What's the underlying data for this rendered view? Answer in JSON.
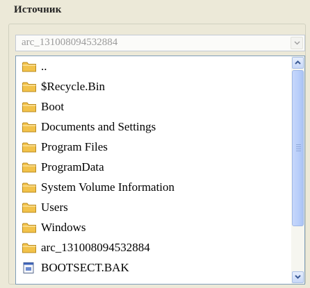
{
  "group": {
    "title": "Источник"
  },
  "source_combo": {
    "value": "arc_131008094532884"
  },
  "file_list": {
    "items": [
      {
        "label": "..",
        "icon": "folder-icon"
      },
      {
        "label": "$Recycle.Bin",
        "icon": "folder-icon"
      },
      {
        "label": "Boot",
        "icon": "folder-icon"
      },
      {
        "label": "Documents and Settings",
        "icon": "folder-icon"
      },
      {
        "label": "Program Files",
        "icon": "folder-icon"
      },
      {
        "label": "ProgramData",
        "icon": "folder-icon"
      },
      {
        "label": "System Volume Information",
        "icon": "folder-icon"
      },
      {
        "label": "Users",
        "icon": "folder-icon"
      },
      {
        "label": "Windows",
        "icon": "folder-icon"
      },
      {
        "label": "arc_131008094532884",
        "icon": "folder-icon"
      },
      {
        "label": "BOOTSECT.BAK",
        "icon": "file-icon"
      }
    ]
  },
  "colors": {
    "folder": "#f2c24a",
    "folder_edge": "#b98a1c",
    "scroll_accent": "#c2d5fb"
  }
}
